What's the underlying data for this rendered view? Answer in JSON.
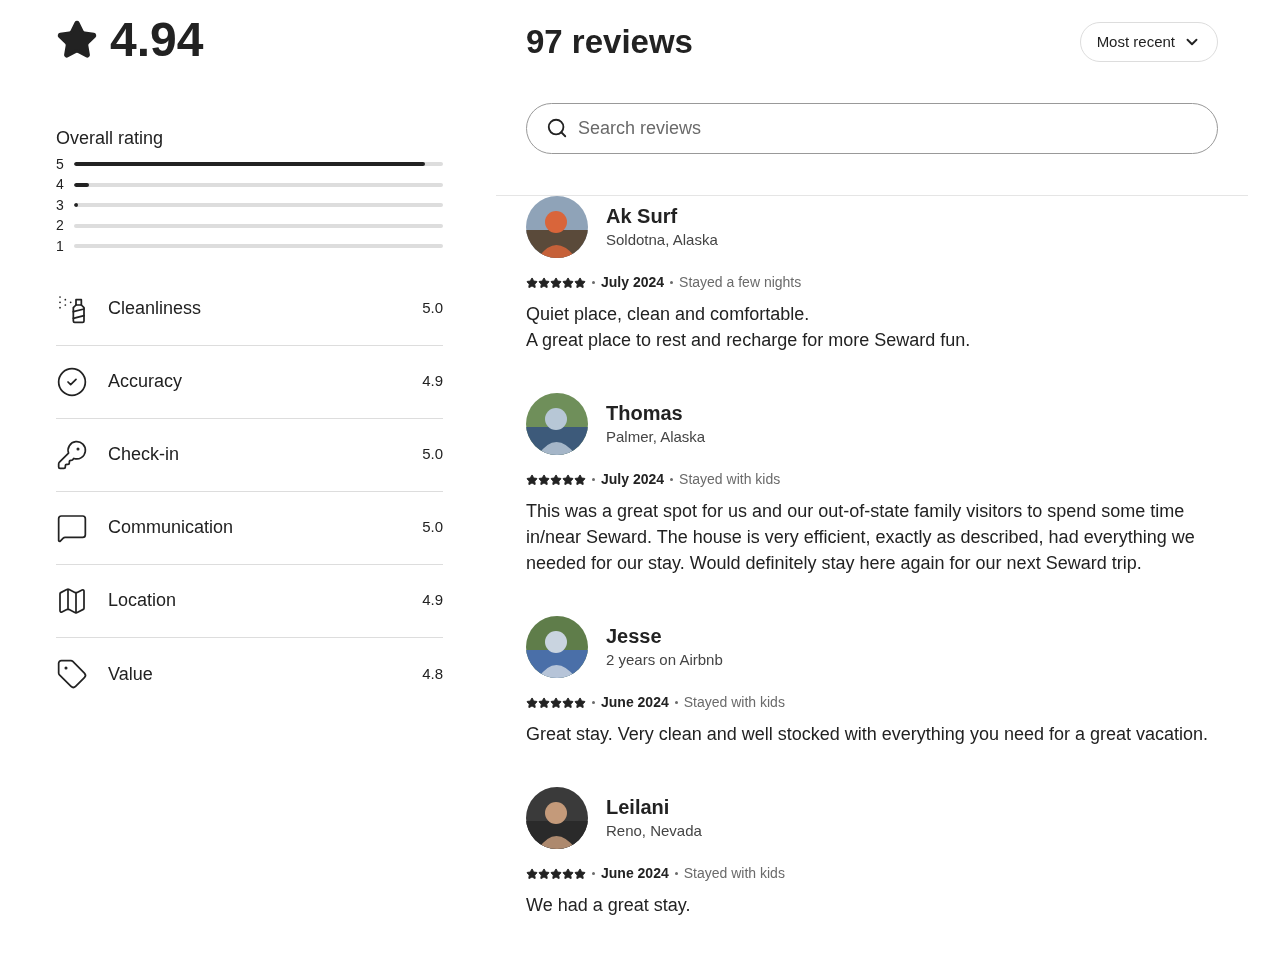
{
  "summary": {
    "score": "4.94",
    "overall_label": "Overall rating",
    "distribution": [
      {
        "label": "5",
        "level": 0.95
      },
      {
        "label": "4",
        "level": 0.04
      },
      {
        "label": "3",
        "level": 0.01
      },
      {
        "label": "2"
      },
      {
        "label": "1"
      }
    ],
    "categories": [
      {
        "kind": "spray",
        "label": "Cleanliness",
        "value": "5.0"
      },
      {
        "kind": "check",
        "label": "Accuracy",
        "value": "4.9"
      },
      {
        "kind": "key",
        "label": "Check-in",
        "value": "5.0"
      },
      {
        "kind": "message",
        "label": "Communication",
        "value": "5.0"
      },
      {
        "kind": "map",
        "label": "Location",
        "value": "4.9"
      },
      {
        "kind": "tag",
        "label": "Value",
        "value": "4.8"
      }
    ]
  },
  "reviews_header": {
    "title": "97 reviews",
    "sort": "Most recent",
    "search_placeholder": "Search reviews"
  },
  "reviews": [
    {
      "name": "Ak Surf",
      "subtitle": "Soldotna, Alaska",
      "stars": 5,
      "date": "July 2024",
      "stay": "Stayed a few nights",
      "text": [
        "Quiet place, clean and comfortable.",
        "A great place to rest and recharge for more Seward fun."
      ]
    },
    {
      "name": "Thomas",
      "subtitle": "Palmer, Alaska",
      "stars": 5,
      "date": "July 2024",
      "stay": "Stayed with kids",
      "text": [
        "This was a great spot for us and our out-of-state family visitors to spend some time in/near Seward. The house is very efficient, exactly as described, had everything we needed for our stay. Would definitely stay here again for our next Seward trip."
      ]
    },
    {
      "name": "Jesse",
      "subtitle": "2 years on Airbnb",
      "stars": 5,
      "date": "June 2024",
      "stay": "Stayed with kids",
      "text": [
        "Great stay. Very clean and well stocked with everything you need for a great vacation."
      ]
    },
    {
      "name": "Leilani",
      "subtitle": "Reno, Nevada",
      "stars": 5,
      "date": "June 2024",
      "stay": "Stayed with kids",
      "text": [
        "We had a great stay."
      ]
    }
  ]
}
